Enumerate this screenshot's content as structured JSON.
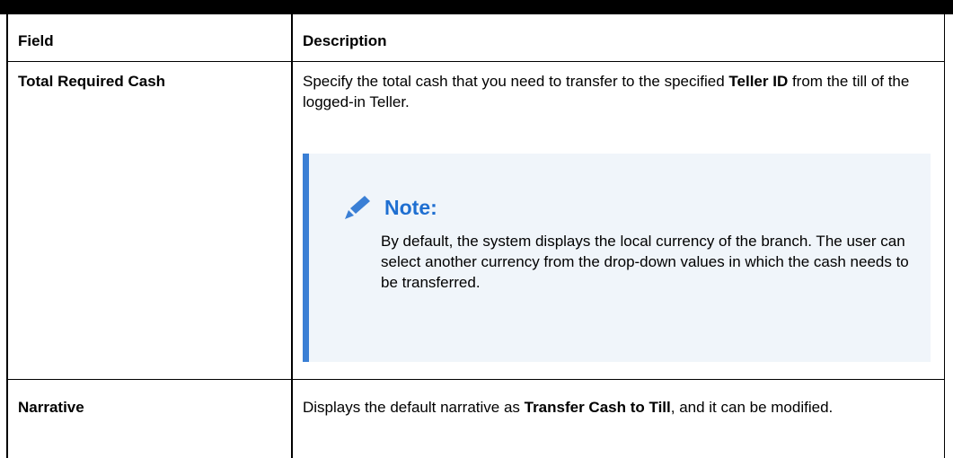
{
  "table": {
    "header": {
      "field": "Field",
      "description": "Description"
    },
    "rows": [
      {
        "field": "Total Required Cash",
        "desc_pre": "Specify the total cash that you need to transfer to the specified ",
        "desc_bold": "Teller ID",
        "desc_post": " from the till of the logged-in Teller.",
        "note": {
          "title": "Note:",
          "body": "By default, the system displays the local currency of the branch. The user can select another currency from the drop-down values in which the cash needs to be transferred."
        }
      },
      {
        "field": "Narrative",
        "desc_pre": "Displays the default narrative as ",
        "desc_bold": "Transfer Cash to Till",
        "desc_post": ", and it can be modified."
      }
    ]
  },
  "colors": {
    "accent": "#3a7fd5",
    "note_title": "#1f6fd1",
    "note_bg": "#f0f5fa"
  },
  "icons": {
    "note_icon": "pencil-icon"
  }
}
